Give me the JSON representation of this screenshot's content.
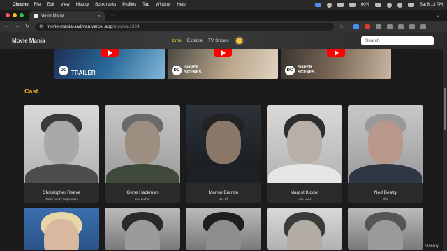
{
  "menubar": {
    "app_name": "Chrome",
    "items": [
      "File",
      "Edit",
      "View",
      "History",
      "Bookmarks",
      "Profiles",
      "Tab",
      "Window",
      "Help"
    ],
    "battery": "60%",
    "clock": "Sat 6:13 PM"
  },
  "browser": {
    "tab_title": "Movie Mania",
    "new_tab": "+",
    "url_host": "movie-mania-sadman.vercel.app",
    "url_path": "/movies/1924"
  },
  "site": {
    "logo": "Movie Mania",
    "nav": [
      "Home",
      "Explore",
      "TV Shows"
    ],
    "search_placeholder": "Search"
  },
  "videos": [
    {
      "badge": "DC",
      "label": "TRAILER"
    },
    {
      "badge": "DC",
      "label_line1": "SUPER",
      "label_line2": "SCENES"
    },
    {
      "badge": "DC",
      "label_line1": "SUPER",
      "label_line2": "SCENES"
    }
  ],
  "cast_heading": "Cast",
  "cast": [
    {
      "name": "Christopher Reeve",
      "role": "Clark Kent / Superman"
    },
    {
      "name": "Gene Hackman",
      "role": "Lex Luthor"
    },
    {
      "name": "Marlon Brando",
      "role": "Jor-El"
    },
    {
      "name": "Margot Kidder",
      "role": "Lois Lane"
    },
    {
      "name": "Ned Beatty",
      "role": "Otis"
    }
  ],
  "watermark": "Udemy"
}
